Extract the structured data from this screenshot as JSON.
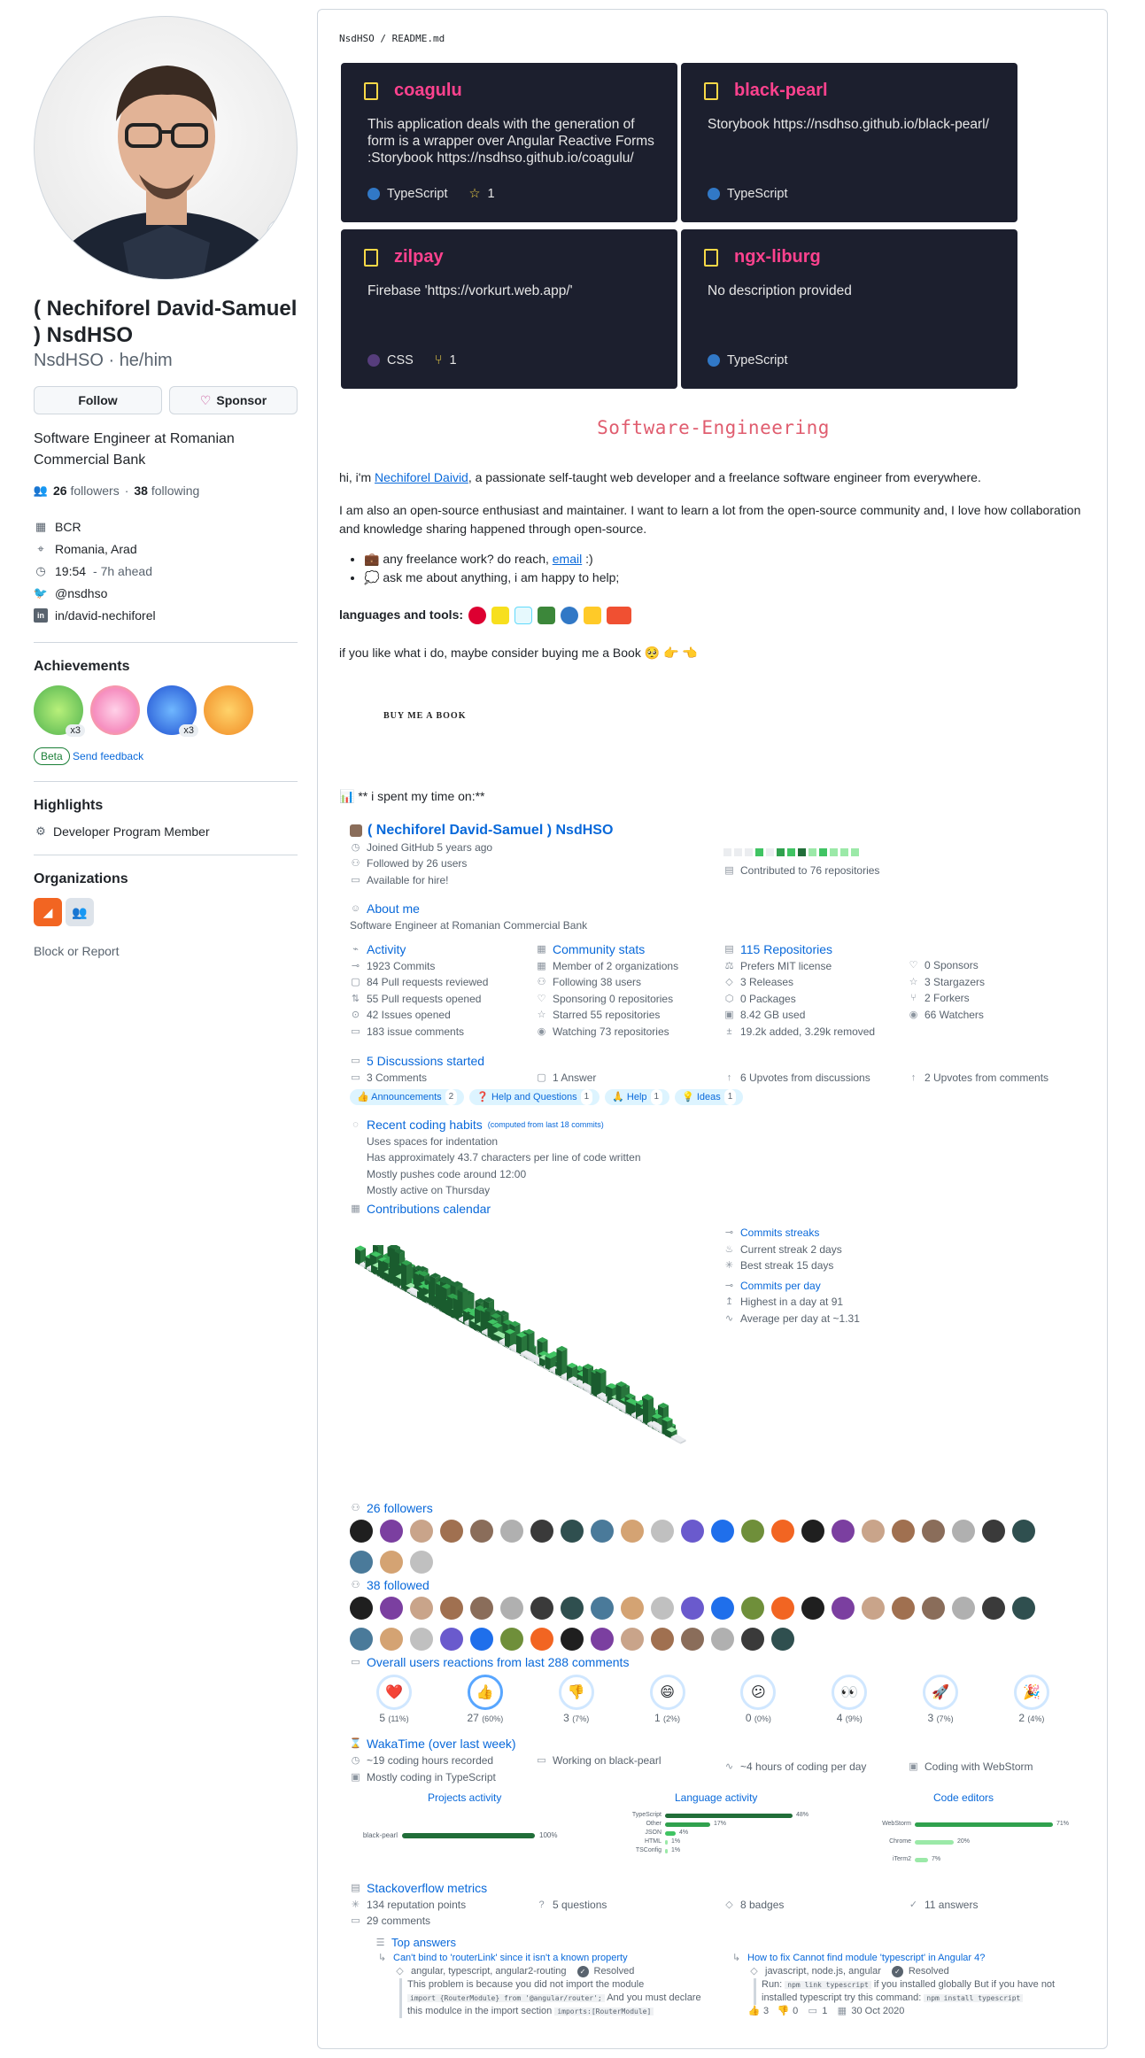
{
  "profile": {
    "full_name": "( Nechiforel David-Samuel ) NsdHSO",
    "login": "NsdHSO",
    "pronouns": "he/him",
    "follow_label": "Follow",
    "sponsor_label": "Sponsor",
    "bio": "Software Engineer at Romanian Commercial Bank",
    "followers_count": "26",
    "followers_label": "followers",
    "following_count": "38",
    "following_label": "following",
    "company": "BCR",
    "location": "Romania, Arad",
    "local_time": "19:54",
    "time_note": "- 7h ahead",
    "twitter": "@nsdhso",
    "linkedin": "in/david-nechiforel",
    "achievements_title": "Achievements",
    "achievements": [
      {
        "icon": "pair-extraordinaire-badge",
        "count": "x3"
      },
      {
        "icon": "yolo-badge",
        "count": ""
      },
      {
        "icon": "pull-shark-badge",
        "count": "x3"
      },
      {
        "icon": "quickdraw-badge",
        "count": ""
      }
    ],
    "beta_label": "Beta",
    "feedback_label": "Send feedback",
    "highlights_title": "Highlights",
    "highlight_item": "Developer Program Member",
    "organizations_title": "Organizations",
    "block_label": "Block or Report"
  },
  "readme": {
    "breadcrumb": "NsdHSO / README.md",
    "repos": [
      {
        "name": "coagulu",
        "description": "This application deals with the generation of form is a wrapper over Angular Reactive Forms :Storybook https://nsdhso.github.io/coagulu/",
        "language": "TypeScript",
        "lang_color": "#3178c6",
        "stat": "1",
        "stat_icon": "star-icon"
      },
      {
        "name": "black-pearl",
        "description": "Storybook https://nsdhso.github.io/black-pearl/",
        "language": "TypeScript",
        "lang_color": "#3178c6",
        "stat": "",
        "stat_icon": ""
      },
      {
        "name": "zilpay",
        "description": "Firebase 'https://vorkurt.web.app/'",
        "language": "CSS",
        "lang_color": "#563d7c",
        "stat": "1",
        "stat_icon": "fork-icon"
      },
      {
        "name": "ngx-liburg",
        "description": "No description provided",
        "language": "TypeScript",
        "lang_color": "#3178c6",
        "stat": "",
        "stat_icon": ""
      }
    ],
    "heading": "Software-Engineering",
    "intro_pre": "hi, i'm ",
    "intro_link": "Nechiforel Daivid",
    "intro_post": ", a passionate self-taught web developer and a freelance software engineer from everywhere.",
    "paragraph": "I am also an open-source enthusiast and maintainer. I want to learn a lot from the open-source community and, I love how collaboration and knowledge sharing happened through open-source.",
    "bullet1_pre": "💼 any freelance work? do reach, ",
    "bullet1_link": "email",
    "bullet1_post": " :)",
    "bullet2": "💭 ask me about anything, i am happy to help;",
    "tools_label": "languages and tools:",
    "book_line": "if you like what i do, maybe consider buying me a Book 🥺 👉 👈",
    "book_logo": "BUY ME A BOOK",
    "spent_line": "📊 ** i spent my time on:**"
  },
  "metrics": {
    "name": "( Nechiforel David-Samuel ) NsdHSO",
    "joined": "Joined GitHub 5 years ago",
    "followed_by": "Followed by 26 users",
    "hire": "Available for hire!",
    "contributed": "Contributed to 76 repositories",
    "about_title": "About me",
    "about_text": "Software Engineer at Romanian Commercial Bank",
    "activity_title": "Activity",
    "activity": [
      "1923 Commits",
      "84 Pull requests reviewed",
      "55 Pull requests opened",
      "42 Issues opened",
      "183 issue comments"
    ],
    "community_title": "Community stats",
    "community": [
      "Member of 2 organizations",
      "Following 38 users",
      "Sponsoring 0 repositories",
      "Starred 55 repositories",
      "Watching 73 repositories"
    ],
    "repos_title": "115 Repositories",
    "repos": [
      "Prefers MIT license",
      "3 Releases",
      "0 Packages",
      "8.42 GB used",
      "19.2k added, 3.29k removed"
    ],
    "repos2": [
      "0 Sponsors",
      "3 Stargazers",
      "2 Forkers",
      "66 Watchers"
    ],
    "discussions_title": "5 Discussions started",
    "discussions": [
      "3 Comments",
      "1 Answer",
      "6 Upvotes from discussions",
      "2 Upvotes from comments"
    ],
    "chips": [
      {
        "label": "👍 Announcements",
        "count": "2"
      },
      {
        "label": "❓ Help and Questions",
        "count": "1"
      },
      {
        "label": "🙏 Help",
        "count": "1"
      },
      {
        "label": "💡 Ideas",
        "count": "1"
      }
    ],
    "habits_title": "Recent coding habits",
    "habits_note": "(computed from last 18 commits)",
    "habits": [
      "Uses spaces for indentation",
      "Has approximately 43.7 characters per line of code written",
      "Mostly pushes code around 12:00",
      "Mostly active on Thursday"
    ],
    "calendar_title": "Contributions calendar",
    "streaks_title": "Commits streaks",
    "current_streak": "Current streak 2 days",
    "best_streak": "Best streak 15 days",
    "perday_title": "Commits per day",
    "highest": "Highest in a day at 91",
    "average": "Average per day at ~1.31",
    "followers_title": "26 followers",
    "followed_title": "38 followed",
    "reactions_title": "Overall users reactions from last 288 comments",
    "reactions": [
      {
        "emoji": "❤️",
        "count": "5",
        "pct": "(11%)",
        "level": 0.11
      },
      {
        "emoji": "👍",
        "count": "27",
        "pct": "(60%)",
        "level": 0.6
      },
      {
        "emoji": "👎",
        "count": "3",
        "pct": "(7%)",
        "level": 0.07
      },
      {
        "emoji": "😄",
        "count": "1",
        "pct": "(2%)",
        "level": 0.02
      },
      {
        "emoji": "😕",
        "count": "0",
        "pct": "(0%)",
        "level": 0.0
      },
      {
        "emoji": "👀",
        "count": "4",
        "pct": "(9%)",
        "level": 0.09
      },
      {
        "emoji": "🚀",
        "count": "3",
        "pct": "(7%)",
        "level": 0.07
      },
      {
        "emoji": "🎉",
        "count": "2",
        "pct": "(4%)",
        "level": 0.04
      }
    ],
    "wakatime_title": "WakaTime (over last week)",
    "waka": [
      "~19 coding hours recorded",
      "Working on black-pearl",
      "~4 hours of coding per day",
      "Coding with WebStorm"
    ],
    "waka_lang": "Mostly coding in TypeScript",
    "projects_title": "Projects activity",
    "projects": [
      {
        "name": "black-pearl",
        "pct": "100%",
        "level": 1.0
      }
    ],
    "languages_title": "Language activity",
    "languages": [
      {
        "name": "TypeScript",
        "pct": "48%",
        "level": 0.48
      },
      {
        "name": "Other",
        "pct": "17%",
        "level": 0.17
      },
      {
        "name": "JSON",
        "pct": "4%",
        "level": 0.04
      },
      {
        "name": "HTML",
        "pct": "1%",
        "level": 0.01
      },
      {
        "name": "TSConfig",
        "pct": "1%",
        "level": 0.01
      }
    ],
    "editors_title": "Code editors",
    "editors": [
      {
        "name": "WebStorm",
        "pct": "71%",
        "level": 0.71
      },
      {
        "name": "Chrome",
        "pct": "20%",
        "level": 0.2
      },
      {
        "name": "iTerm2",
        "pct": "7%",
        "level": 0.07
      }
    ],
    "so_title": "Stackoverflow metrics",
    "so": [
      "134 reputation points",
      "5 questions",
      "8 badges",
      "11 answers"
    ],
    "so_comments": "29 comments",
    "top_answers_title": "Top answers",
    "answer1": {
      "title": "Can't bind to 'routerLink' since it isn't a known property",
      "tags": "angular, typescript, angular2-routing",
      "resolved": "Resolved",
      "text1": "This problem is because you did not import the module",
      "code1": "import {RouterModule} from '@angular/router';",
      "text2": " And you must declare",
      "text3": "this modulce in the import section ",
      "code2": "imports:[RouterModule]"
    },
    "answer2": {
      "title": "How to fix Cannot find module 'typescript' in Angular 4?",
      "tags": "javascript, node.js, angular",
      "resolved": "Resolved",
      "text1": "Run: ",
      "code1": "npm link typescript",
      "text2": " if you installed globally But if you have not",
      "text3": "installed typescript try this command: ",
      "code2": "npm install typescript",
      "up": "3",
      "down": "0",
      "comments": "1",
      "date": "30 Oct 2020"
    }
  },
  "colors": {
    "accent": "#0969da",
    "card_bg": "#1c1f2e",
    "card_title": "#fe428e",
    "heading": "#e05d6f",
    "green": "#1a7f37"
  }
}
